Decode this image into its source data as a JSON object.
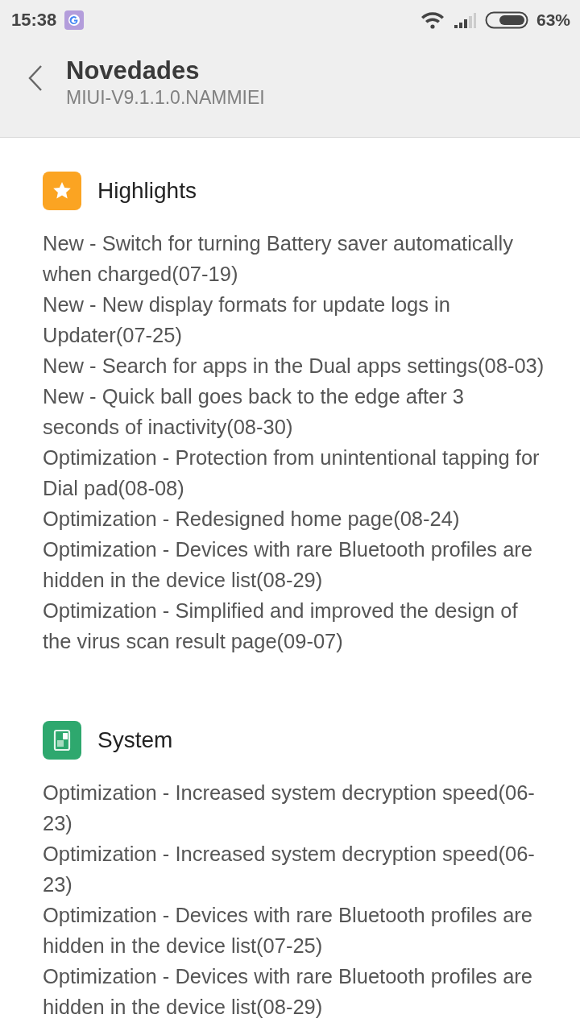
{
  "status_bar": {
    "time": "15:38",
    "battery": "63%"
  },
  "header": {
    "title": "Novedades",
    "subtitle": "MIUI-V9.1.1.0.NAMMIEI"
  },
  "sections": [
    {
      "kind": "star",
      "title": "Highlights",
      "items": [
        "New - Switch for turning Battery saver automatically when charged(07-19)",
        "New - New display formats for update logs in Updater(07-25)",
        "New - Search for apps in the Dual apps settings(08-03)",
        "New - Quick ball goes back to the edge after 3 seconds of inactivity(08-30)",
        "Optimization - Protection from unintentional tapping for Dial pad(08-08)",
        "Optimization - Redesigned home page(08-24)",
        "Optimization - Devices with rare Bluetooth profiles are hidden in the device list(08-29)",
        "Optimization - Simplified and improved the design of the virus scan result page(09-07)"
      ]
    },
    {
      "kind": "system",
      "title": "System",
      "items": [
        "Optimization - Increased system decryption speed(06-23)",
        "Optimization - Increased system decryption speed(06-23)",
        "Optimization - Devices with rare Bluetooth profiles are hidden in the device list(07-25)",
        "Optimization - Devices with rare Bluetooth profiles are hidden in the device list(08-29)"
      ]
    }
  ]
}
